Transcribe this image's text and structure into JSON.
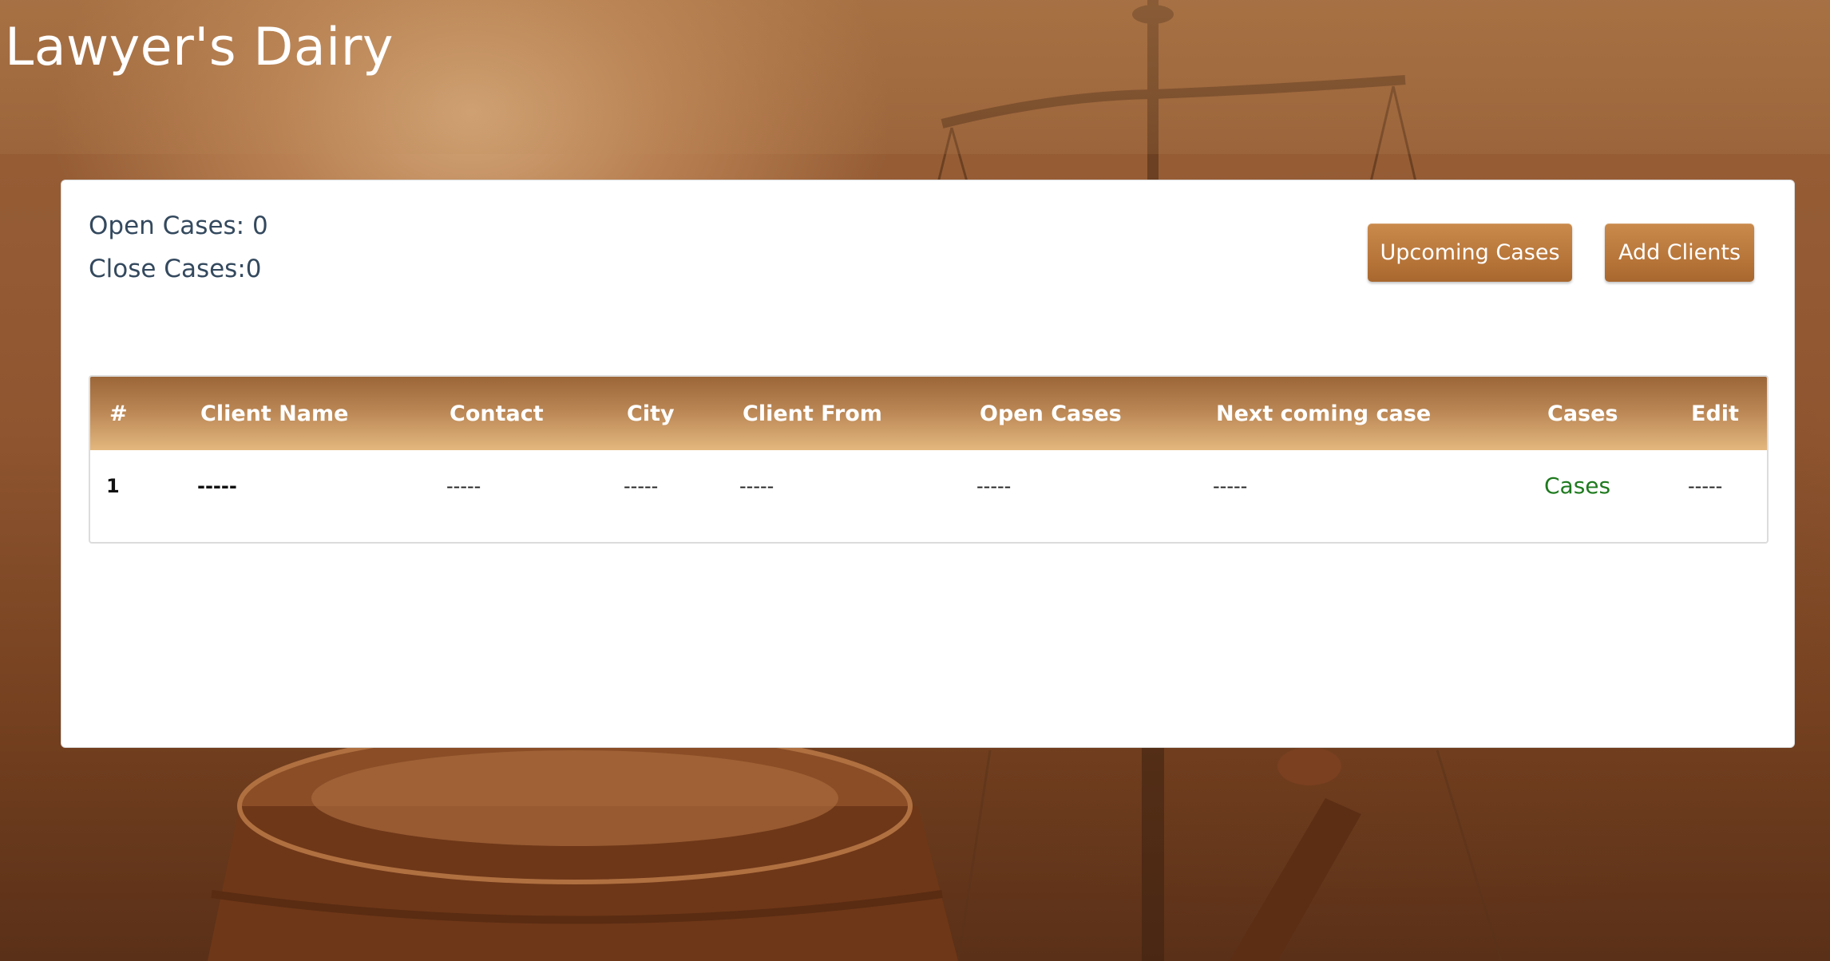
{
  "app": {
    "title": "Lawyer's Dairy"
  },
  "stats": {
    "open_cases": "Open Cases: 0",
    "close_cases": "Close Cases:0"
  },
  "actions": {
    "upcoming_cases_label": "Upcoming Cases",
    "add_clients_label": "Add Clients"
  },
  "table": {
    "headers": [
      "#",
      "Client Name",
      "Contact",
      "City",
      "Client From",
      "Open Cases",
      "Next coming case",
      "Cases",
      "Edit"
    ],
    "rows": [
      {
        "index": "1",
        "client_name": "-----",
        "contact": "-----",
        "city": "-----",
        "client_from": "-----",
        "open_cases": "-----",
        "next_coming_case": "-----",
        "cases": "Cases",
        "edit": "-----"
      }
    ]
  },
  "colors": {
    "accent": "#b8763a",
    "header_gradient_top": "#9c6638",
    "header_gradient_bottom": "#e3b77e",
    "link_green": "#1f7a1f",
    "stat_text": "#34495e"
  }
}
